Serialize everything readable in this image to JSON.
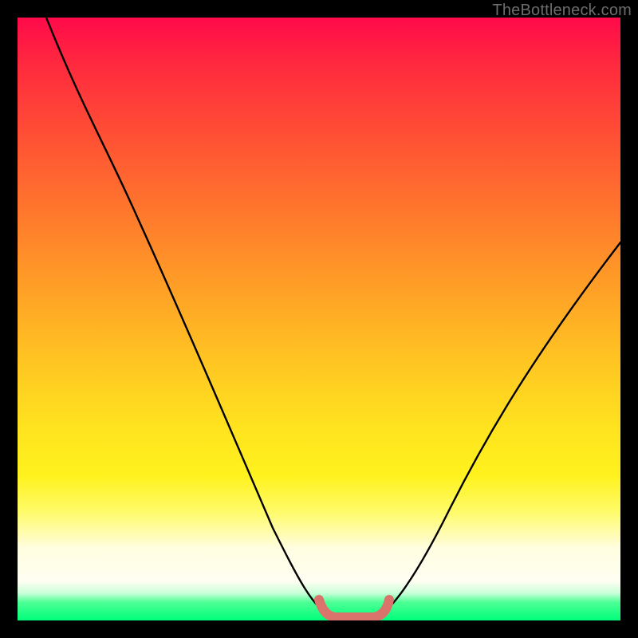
{
  "watermark": {
    "text": "TheBottleneck.com"
  },
  "colors": {
    "curve": "#000000",
    "flat_marker": "#d9736b",
    "gradient_top": "#ff0a4a",
    "gradient_bottom": "#00ff7b"
  },
  "chart_data": {
    "type": "line",
    "title": "",
    "xlabel": "",
    "ylabel": "",
    "xlim": [
      0,
      100
    ],
    "ylim": [
      0,
      100
    ],
    "grid": false,
    "legend": false,
    "series": [
      {
        "name": "bottleneck-curve",
        "x": [
          5,
          10,
          15,
          20,
          25,
          30,
          35,
          40,
          45,
          48,
          50,
          52,
          55,
          58,
          60,
          65,
          70,
          75,
          80,
          85,
          90,
          95,
          98
        ],
        "y": [
          100,
          92,
          83,
          74,
          64,
          54,
          44,
          34,
          23,
          13,
          5,
          1,
          0,
          0,
          1,
          5,
          12,
          20,
          28,
          36,
          43,
          50,
          54
        ]
      }
    ],
    "annotations": [
      {
        "name": "flat-bottom-marker",
        "shape": "rounded-segment",
        "x_start": 50,
        "x_end": 60,
        "y": 0.5,
        "thickness_px": 12,
        "color": "#d9736b"
      }
    ]
  }
}
